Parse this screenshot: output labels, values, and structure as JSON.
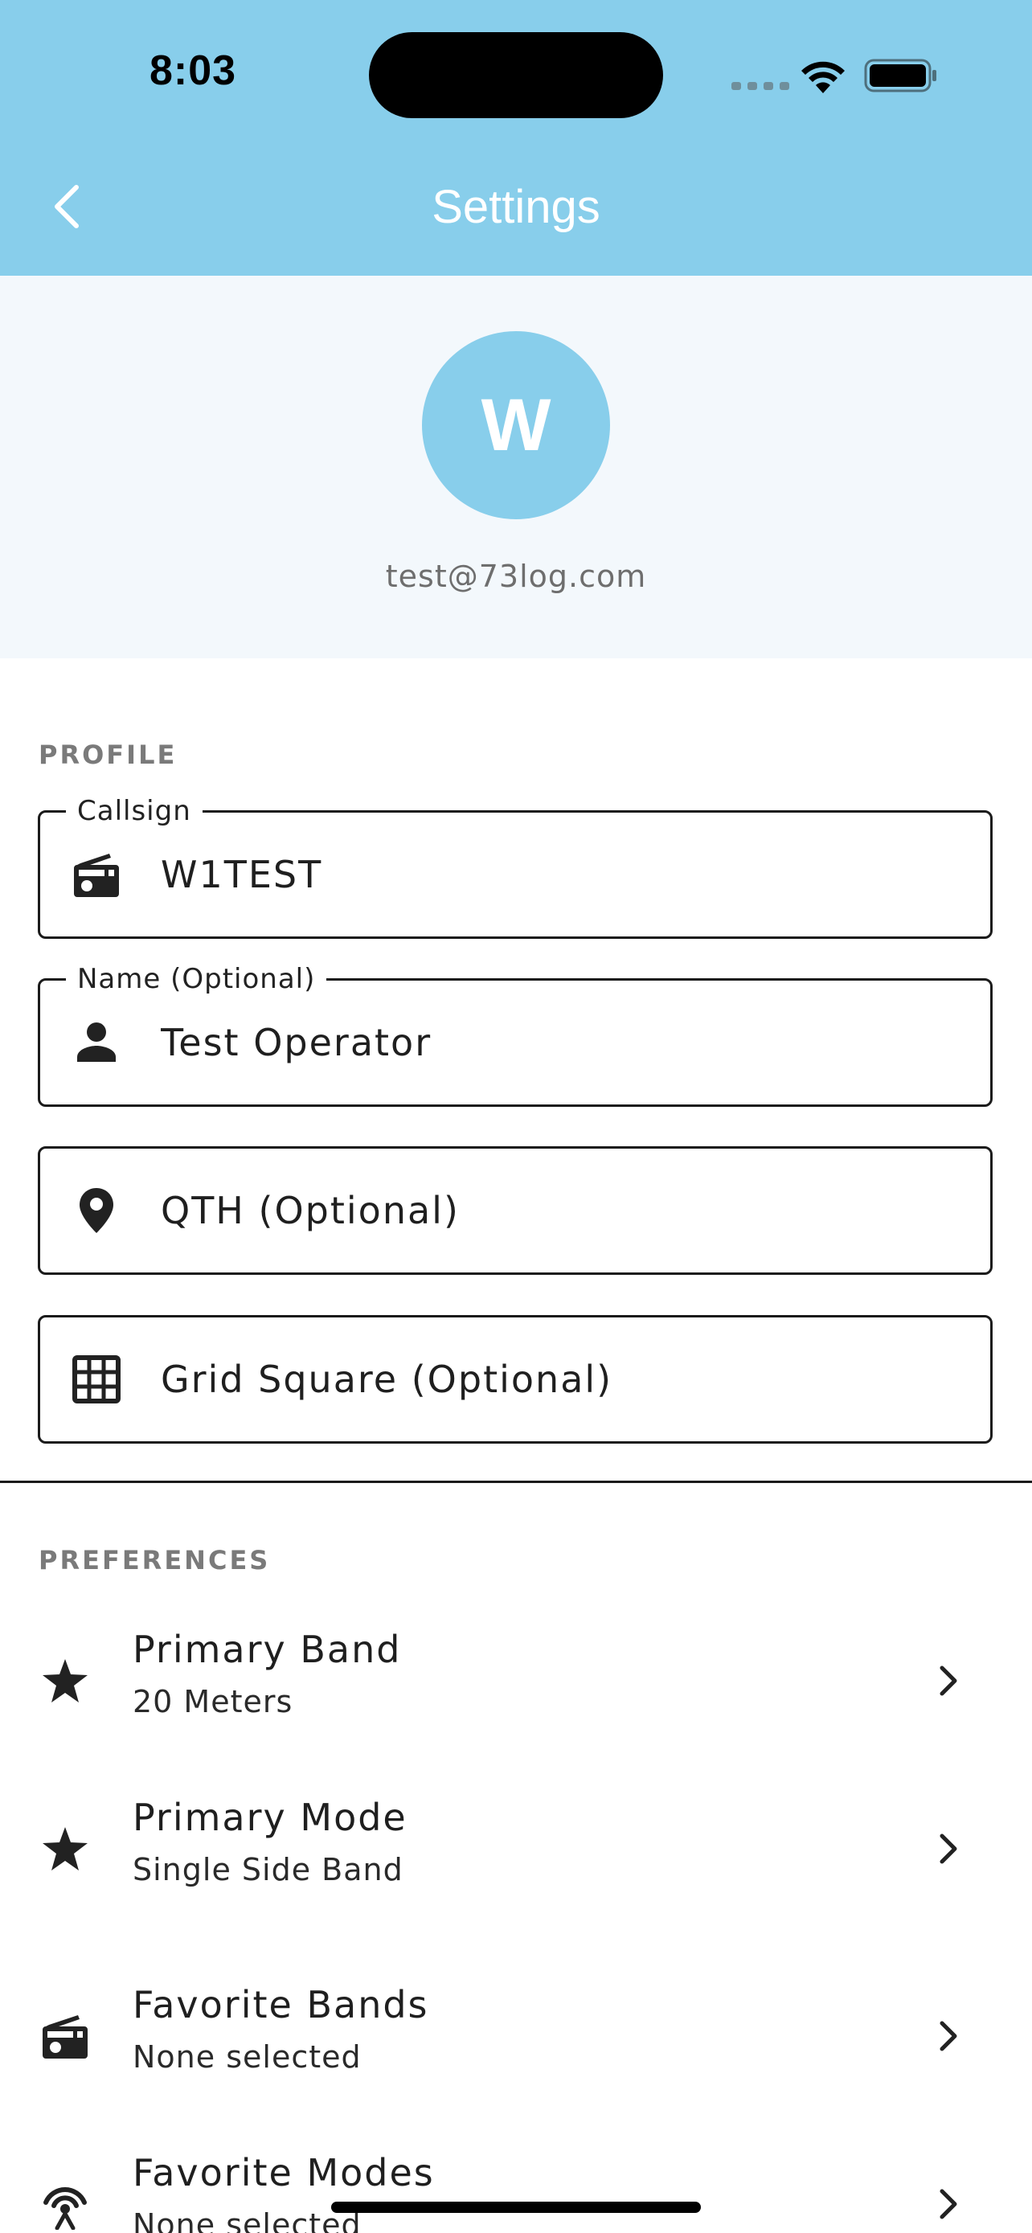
{
  "status_bar": {
    "time": "8:03"
  },
  "header": {
    "title": "Settings",
    "background_color": "#88ceeb",
    "back_icon": "chevron-left-icon"
  },
  "profile_summary": {
    "avatar_initial": "W",
    "avatar_color": "#88ceeb",
    "email": "test@73log.com"
  },
  "profile_section": {
    "label": "PROFILE",
    "fields": [
      {
        "label": "Callsign",
        "value": "W1TEST",
        "placeholder": "",
        "icon": "radio-icon"
      },
      {
        "label": "Name (Optional)",
        "value": "Test Operator",
        "placeholder": "",
        "icon": "person-icon"
      },
      {
        "label": "",
        "value": "",
        "placeholder": "QTH (Optional)",
        "icon": "location-pin-icon"
      },
      {
        "label": "",
        "value": "",
        "placeholder": "Grid Square (Optional)",
        "icon": "grid-icon"
      }
    ]
  },
  "preferences_section": {
    "label": "PREFERENCES",
    "items": [
      {
        "title": "Primary Band",
        "subtitle": "20 Meters",
        "icon": "star-icon"
      },
      {
        "title": "Primary Mode",
        "subtitle": "Single Side Band",
        "icon": "star-icon"
      },
      {
        "title": "Favorite Bands",
        "subtitle": "None selected",
        "icon": "radio-icon"
      },
      {
        "title": "Favorite Modes",
        "subtitle": "None selected",
        "icon": "antenna-icon"
      }
    ]
  }
}
